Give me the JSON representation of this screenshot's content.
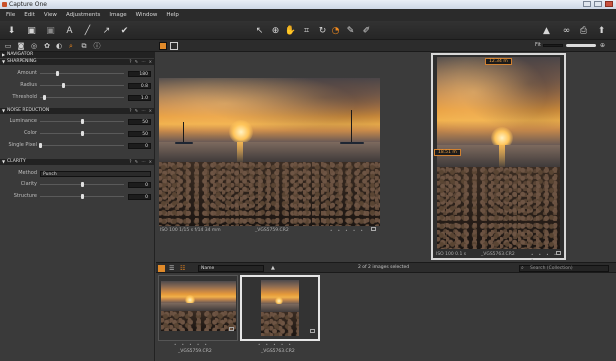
{
  "window": {
    "title": "Capture One"
  },
  "menu": [
    "File",
    "Edit",
    "View",
    "Adjustments",
    "Image",
    "Window",
    "Help"
  ],
  "toolbar": {
    "left_icons": [
      "import-icon",
      "camera-icon",
      "camera-grey-icon",
      "text-icon",
      "brush-icon",
      "arrow-icon",
      "pen-icon"
    ],
    "center_icons": [
      "pointer-icon",
      "pan-icon",
      "hand-icon",
      "crop-icon",
      "straighten-icon",
      "rotate-icon",
      "picker-icon",
      "healing-icon"
    ],
    "right_icons": [
      "warning-icon",
      "glasses-icon",
      "print-icon",
      "export-icon"
    ]
  },
  "viewbar": {
    "fit_label": "Fit"
  },
  "panels": {
    "navigator": {
      "title": "NAVIGATOR"
    },
    "sharpening": {
      "title": "SHARPENING",
      "rows": [
        {
          "label": "Amount",
          "value": "180",
          "pos": 0.2
        },
        {
          "label": "Radius",
          "value": "0.8",
          "pos": 0.27
        },
        {
          "label": "Threshold",
          "value": "1.0",
          "pos": 0.05
        }
      ]
    },
    "noise_reduction": {
      "title": "NOISE REDUCTION",
      "rows": [
        {
          "label": "Luminance",
          "value": "50",
          "pos": 0.5
        },
        {
          "label": "Color",
          "value": "50",
          "pos": 0.5
        },
        {
          "label": "Single Pixel",
          "value": "0",
          "pos": 0.0
        }
      ]
    },
    "clarity": {
      "title": "CLARITY",
      "method_label": "Method",
      "method_value": "Punch",
      "rows": [
        {
          "label": "Clarity",
          "value": "0",
          "pos": 0.5
        },
        {
          "label": "Structure",
          "value": "0",
          "pos": 0.5
        }
      ]
    }
  },
  "viewer": {
    "left_image": {
      "caption": "ISO 100  1/15 s  f/14  34 mm",
      "filename": "_VGS5759.CR2"
    },
    "right_image": {
      "caption": "ISO 100  0.1 s",
      "filename": "_VGS5763.CR2",
      "tag_top": "12.34 m",
      "tag_mid": "18.51 m"
    }
  },
  "browser": {
    "sort_label": "Name",
    "status": "2 of 2 images selected",
    "search_placeholder": "Search (Collection)",
    "thumbs": [
      {
        "filename": "_VGS5759.CR2",
        "selected": false
      },
      {
        "filename": "_VGS5763.CR2",
        "selected": true
      }
    ]
  }
}
